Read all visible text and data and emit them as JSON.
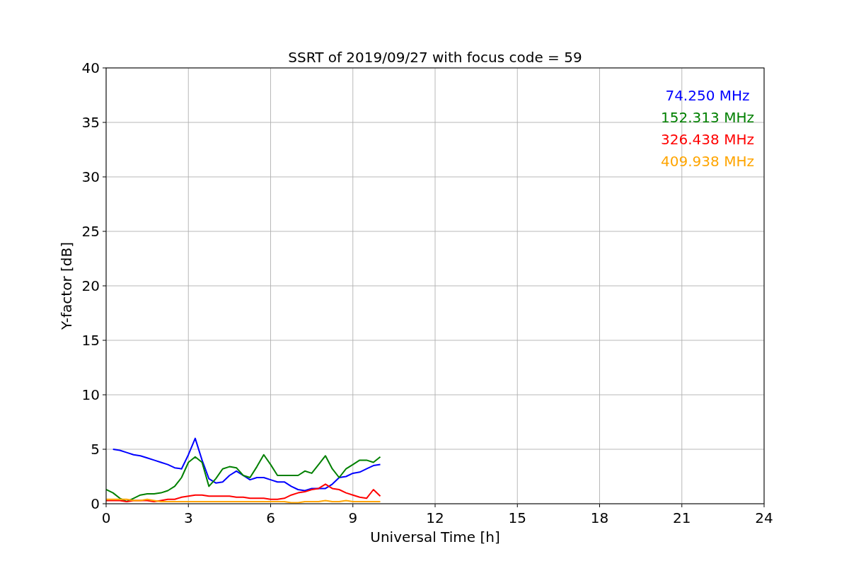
{
  "chart_data": {
    "type": "line",
    "title": "SSRT of 2019/09/27 with focus code = 59",
    "xlabel": "Universal Time [h]",
    "ylabel": "Y-factor [dB]",
    "x": [
      0,
      0.25,
      0.5,
      0.75,
      1,
      1.25,
      1.5,
      1.75,
      2,
      2.25,
      2.5,
      2.75,
      3,
      3.25,
      3.5,
      3.75,
      4,
      4.25,
      4.5,
      4.75,
      5,
      5.25,
      5.5,
      5.75,
      6,
      6.25,
      6.5,
      6.75,
      7,
      7.25,
      7.5,
      7.75,
      8,
      8.25,
      8.5,
      8.75,
      9,
      9.25,
      9.5,
      9.75,
      10
    ],
    "series": [
      {
        "name": "74.250 MHz",
        "color": "#0000ff",
        "values": [
          null,
          5.0,
          4.9,
          4.7,
          4.5,
          4.4,
          4.2,
          4.0,
          3.8,
          3.6,
          3.3,
          3.2,
          4.5,
          6.0,
          4.0,
          2.3,
          1.9,
          2.0,
          2.6,
          3.0,
          2.6,
          2.2,
          2.4,
          2.4,
          2.2,
          2.0,
          2.0,
          1.6,
          1.3,
          1.2,
          1.4,
          1.4,
          1.4,
          1.8,
          2.4,
          2.5,
          2.8,
          2.9,
          3.2,
          3.5,
          3.6
        ]
      },
      {
        "name": "152.313 MHz",
        "color": "#008000",
        "values": [
          1.3,
          1.0,
          0.5,
          0.2,
          0.5,
          0.8,
          0.9,
          0.9,
          1.0,
          1.2,
          1.6,
          2.4,
          3.8,
          4.3,
          3.8,
          1.6,
          2.3,
          3.2,
          3.4,
          3.3,
          2.6,
          2.4,
          3.4,
          4.5,
          3.6,
          2.6,
          2.6,
          2.6,
          2.6,
          3.0,
          2.8,
          3.6,
          4.4,
          3.2,
          2.4,
          3.2,
          3.6,
          4.0,
          4.0,
          3.8,
          4.3
        ]
      },
      {
        "name": "326.438 MHz",
        "color": "#ff0000",
        "values": [
          0.3,
          0.3,
          0.3,
          0.2,
          0.3,
          0.3,
          0.3,
          0.2,
          0.3,
          0.4,
          0.4,
          0.6,
          0.7,
          0.8,
          0.8,
          0.7,
          0.7,
          0.7,
          0.7,
          0.6,
          0.6,
          0.5,
          0.5,
          0.5,
          0.4,
          0.4,
          0.5,
          0.8,
          1.0,
          1.1,
          1.3,
          1.4,
          1.8,
          1.4,
          1.3,
          1.0,
          0.8,
          0.6,
          0.5,
          1.3,
          0.7
        ]
      },
      {
        "name": "409.938 MHz",
        "color": "#ffa500",
        "values": [
          0.4,
          0.4,
          0.4,
          0.4,
          0.3,
          0.3,
          0.4,
          0.3,
          0.2,
          0.2,
          0.2,
          0.2,
          0.2,
          0.2,
          0.2,
          0.2,
          0.2,
          0.2,
          0.2,
          0.2,
          0.2,
          0.2,
          0.2,
          0.2,
          0.2,
          0.2,
          0.2,
          0.1,
          0.1,
          0.2,
          0.2,
          0.2,
          0.3,
          0.2,
          0.2,
          0.3,
          0.2,
          0.2,
          0.2,
          0.2,
          0.2
        ]
      }
    ],
    "xlim": [
      0,
      24
    ],
    "ylim": [
      0,
      40
    ],
    "xticks": [
      0,
      3,
      6,
      9,
      12,
      15,
      18,
      21,
      24
    ],
    "yticks": [
      0,
      5,
      10,
      15,
      20,
      25,
      30,
      35,
      40
    ],
    "grid": true
  }
}
